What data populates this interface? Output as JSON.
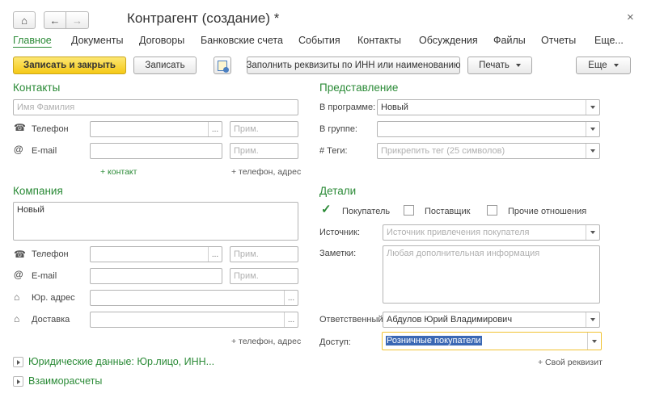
{
  "window": {
    "title": "Контрагент (создание) *",
    "close_glyph": "×"
  },
  "nav": {
    "home_icon": "home-icon",
    "back_icon": "arrow-left-icon",
    "forward_icon": "arrow-right-icon"
  },
  "tabs": [
    "Главное",
    "Документы",
    "Договоры",
    "Банковские счета",
    "События",
    "Контакты",
    "Обсуждения",
    "Файлы",
    "Отчеты",
    "Еще..."
  ],
  "toolbar": {
    "save_close": "Записать и закрыть",
    "save": "Записать",
    "fill_by_inn": "Заполнить реквизиты по ИНН или наименованию",
    "print": "Печать",
    "more": "Еще"
  },
  "contacts": {
    "heading": "Контакты",
    "name_placeholder": "Имя Фамилия",
    "phone_label": "Телефон",
    "email_label": "E-mail",
    "note_placeholder": "Прим.",
    "add_contact": "+ контакт",
    "add_phone_address": "+ телефон, адрес"
  },
  "company": {
    "heading": "Компания",
    "name_value": "Новый",
    "phone_label": "Телефон",
    "email_label": "E-mail",
    "legal_address_label": "Юр. адрес",
    "delivery_label": "Доставка",
    "note_placeholder": "Прим.",
    "add_phone_address": "+ телефон, адрес"
  },
  "representation": {
    "heading": "Представление",
    "in_program_label": "В программе:",
    "in_program_value": "Новый",
    "in_group_label": "В группе:",
    "tags_label": "# Теги:",
    "tags_placeholder": "Прикрепить тег (25 символов)"
  },
  "details": {
    "heading": "Детали",
    "buyer_label": "Покупатель",
    "buyer_checked": true,
    "supplier_label": "Поставщик",
    "supplier_checked": false,
    "other_label": "Прочие отношения",
    "other_checked": false,
    "source_label": "Источник:",
    "source_placeholder": "Источник привлечения покупателя",
    "notes_label": "Заметки:",
    "notes_placeholder": "Любая дополнительная информация",
    "responsible_label": "Ответственный:",
    "responsible_value": "Абдулов Юрий Владимирович",
    "access_label": "Доступ:",
    "access_value": "Розничные покупатели",
    "add_requisite": "+ Свой реквизит"
  },
  "groups": {
    "legal": "Юридические данные: Юр.лицо, ИНН...",
    "settlements": "Взаиморасчеты"
  },
  "colors": {
    "accent_green": "#2a8a36",
    "primary_button": "#f5c917",
    "focus_border": "#f1c232",
    "selection": "#3b68b4"
  }
}
